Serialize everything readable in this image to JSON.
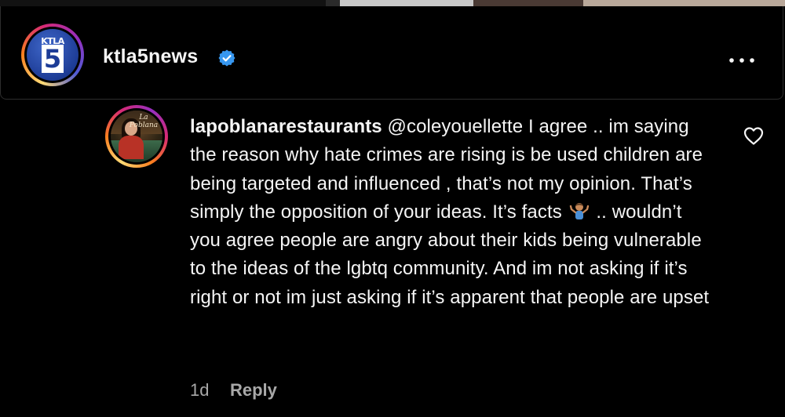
{
  "post": {
    "account": {
      "username": "ktla5news",
      "verified": true,
      "logo_text_top": "KTLA",
      "logo_text_number": "5"
    },
    "more_icon": "more-horizontal-icon"
  },
  "comment": {
    "author": "lapoblanarestaurants",
    "avatar_caption": "La Poblana",
    "mention": "@coleyouellette",
    "text_before_emoji": " I agree .. im saying the reason why hate crimes are rising is be used children are being targeted and influenced , that’s not my opinion. That’s simply the opposition of your ideas. It’s facts",
    "emoji": "person-shrugging-emoji",
    "text_after_emoji": ".. wouldn’t you agree people are angry about their kids being vulnerable to the ideas of the lgbtq community. And im not asking if it’s right or not im just asking if it’s apparent that people are upset",
    "time_ago": "1d",
    "reply_label": "Reply",
    "like_icon": "heart-icon"
  },
  "colors": {
    "background": "#000000",
    "text": "#f5f5f5",
    "secondary_text": "#a8a8a8",
    "verified_badge": "#3797f0"
  }
}
